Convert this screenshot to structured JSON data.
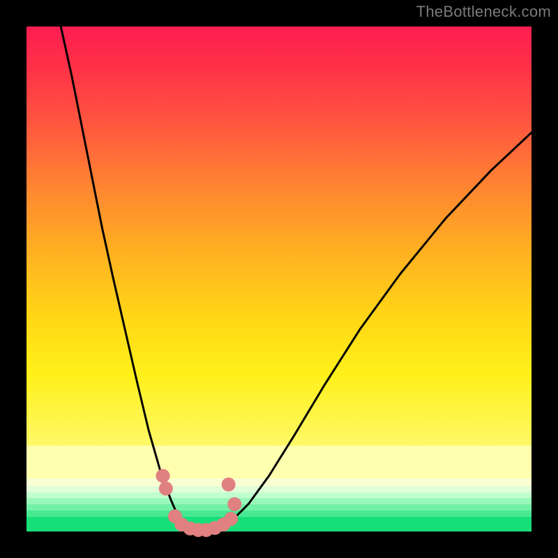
{
  "watermark": "TheBottleneck.com",
  "chart_data": {
    "type": "line",
    "title": "",
    "xlabel": "",
    "ylabel": "",
    "xlim": [
      0,
      100
    ],
    "ylim": [
      0,
      100
    ],
    "grid": false,
    "curves": [
      {
        "name": "left-branch",
        "points": [
          {
            "x": 6.8,
            "y": 100.0
          },
          {
            "x": 9.0,
            "y": 90.0
          },
          {
            "x": 11.0,
            "y": 80.0
          },
          {
            "x": 13.0,
            "y": 70.0
          },
          {
            "x": 15.0,
            "y": 60.0
          },
          {
            "x": 17.2,
            "y": 50.0
          },
          {
            "x": 19.5,
            "y": 40.0
          },
          {
            "x": 21.8,
            "y": 30.0
          },
          {
            "x": 24.2,
            "y": 20.0
          },
          {
            "x": 26.5,
            "y": 12.0
          },
          {
            "x": 28.5,
            "y": 6.5
          },
          {
            "x": 30.0,
            "y": 3.0
          },
          {
            "x": 32.0,
            "y": 1.0
          },
          {
            "x": 34.0,
            "y": 0.2
          }
        ]
      },
      {
        "name": "right-branch",
        "points": [
          {
            "x": 36.0,
            "y": 0.2
          },
          {
            "x": 38.5,
            "y": 1.0
          },
          {
            "x": 41.0,
            "y": 2.5
          },
          {
            "x": 44.0,
            "y": 5.5
          },
          {
            "x": 48.0,
            "y": 11.0
          },
          {
            "x": 53.0,
            "y": 19.0
          },
          {
            "x": 59.0,
            "y": 29.0
          },
          {
            "x": 66.0,
            "y": 40.0
          },
          {
            "x": 74.0,
            "y": 51.0
          },
          {
            "x": 83.0,
            "y": 62.0
          },
          {
            "x": 92.0,
            "y": 71.5
          },
          {
            "x": 100.0,
            "y": 79.0
          }
        ]
      }
    ],
    "markers": {
      "name": "salmon-dots",
      "color": "#e08080",
      "points": [
        {
          "x": 27.0,
          "y": 11.0
        },
        {
          "x": 27.6,
          "y": 8.5
        },
        {
          "x": 29.4,
          "y": 3.0
        },
        {
          "x": 30.7,
          "y": 1.4
        },
        {
          "x": 32.4,
          "y": 0.6
        },
        {
          "x": 34.0,
          "y": 0.3
        },
        {
          "x": 35.6,
          "y": 0.3
        },
        {
          "x": 37.3,
          "y": 0.7
        },
        {
          "x": 39.0,
          "y": 1.4
        },
        {
          "x": 40.5,
          "y": 2.5
        },
        {
          "x": 41.2,
          "y": 5.4
        },
        {
          "x": 40.0,
          "y": 9.3
        }
      ]
    },
    "background_bands": [
      {
        "name": "red-to-yellow-gradient",
        "from_y": 17,
        "to_y": 100
      },
      {
        "name": "pale-yellow",
        "from_y": 10.5,
        "to_y": 17
      },
      {
        "name": "cream",
        "from_y": 9.0,
        "to_y": 10.5
      },
      {
        "name": "mint-1",
        "from_y": 7.8,
        "to_y": 9.0
      },
      {
        "name": "mint-2",
        "from_y": 6.6,
        "to_y": 7.8
      },
      {
        "name": "mint-3",
        "from_y": 5.4,
        "to_y": 6.6
      },
      {
        "name": "mint-4",
        "from_y": 4.2,
        "to_y": 5.4
      },
      {
        "name": "green-1",
        "from_y": 2.9,
        "to_y": 4.2
      },
      {
        "name": "green-2",
        "from_y": 0.0,
        "to_y": 2.9
      }
    ]
  }
}
